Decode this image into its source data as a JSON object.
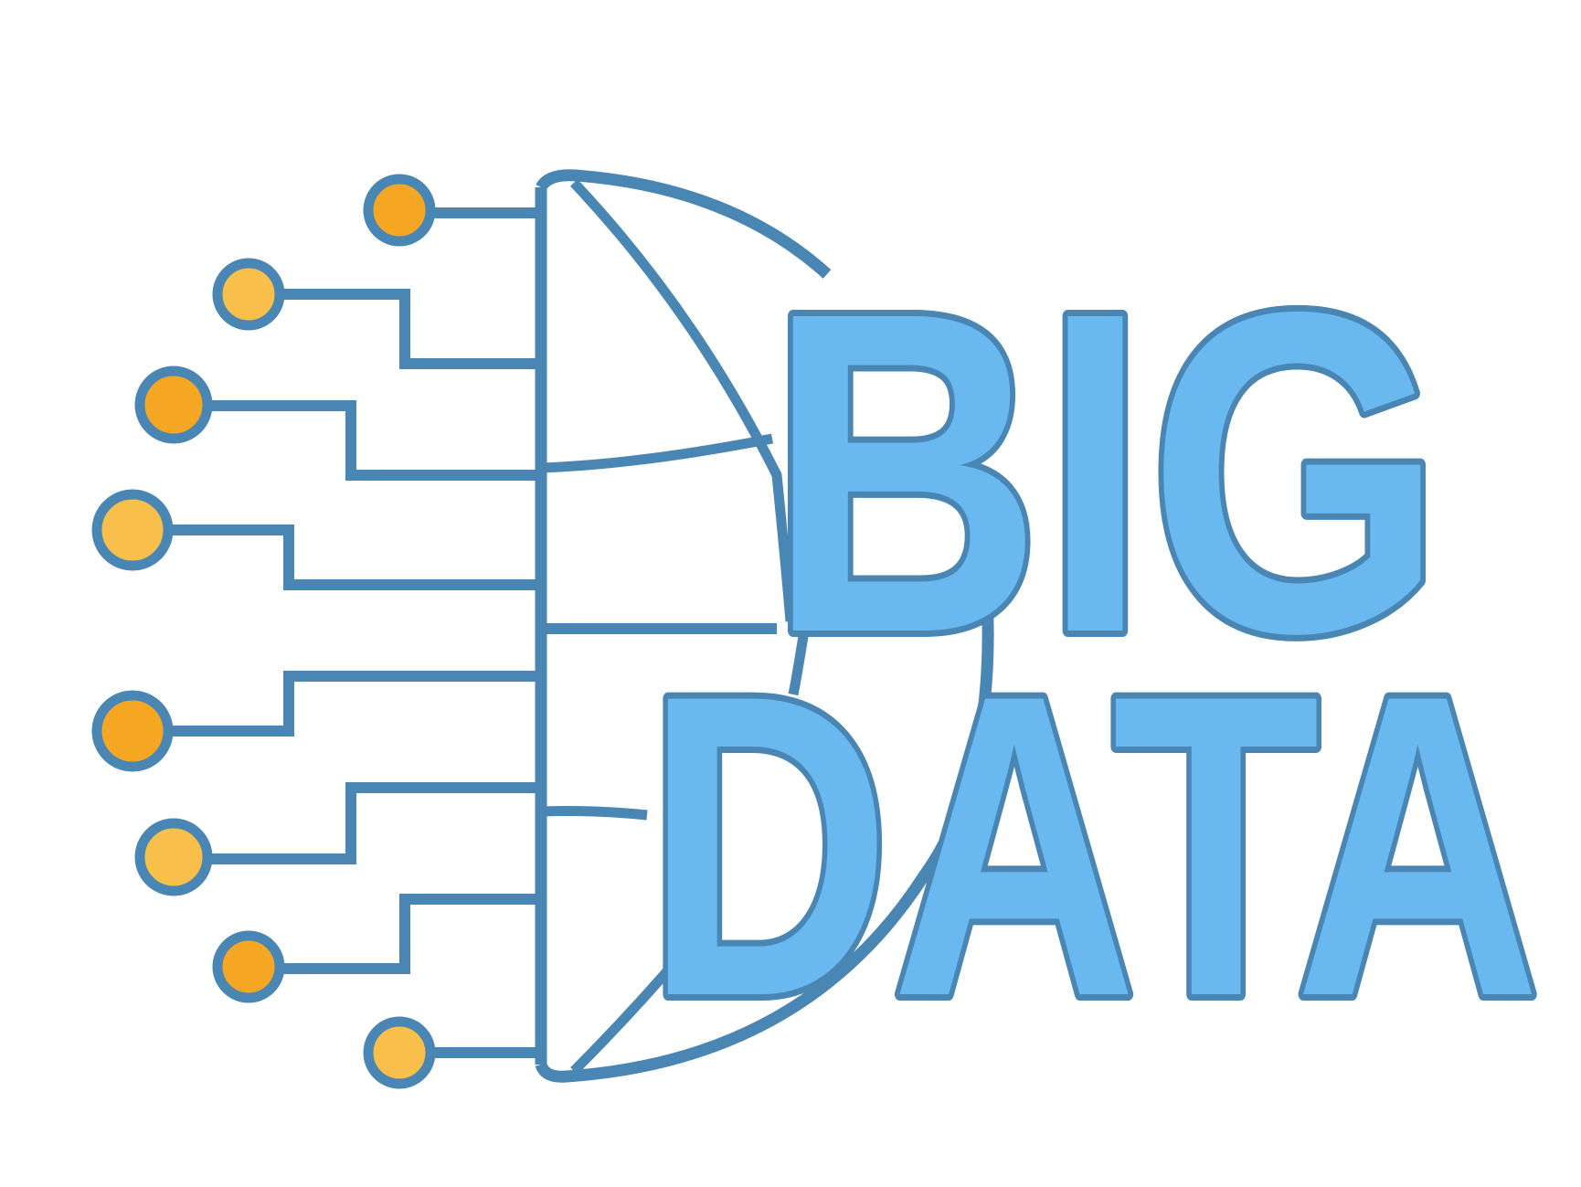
{
  "logo": {
    "line1": "BIG",
    "line2": "DATA",
    "colors": {
      "stroke": "#4a86b4",
      "letter_fill": "#6ab8f0",
      "node_dark": "#f5a623",
      "node_light": "#f8bf4a",
      "background": "#ffffff"
    },
    "icon": "circuit-brain-icon"
  }
}
